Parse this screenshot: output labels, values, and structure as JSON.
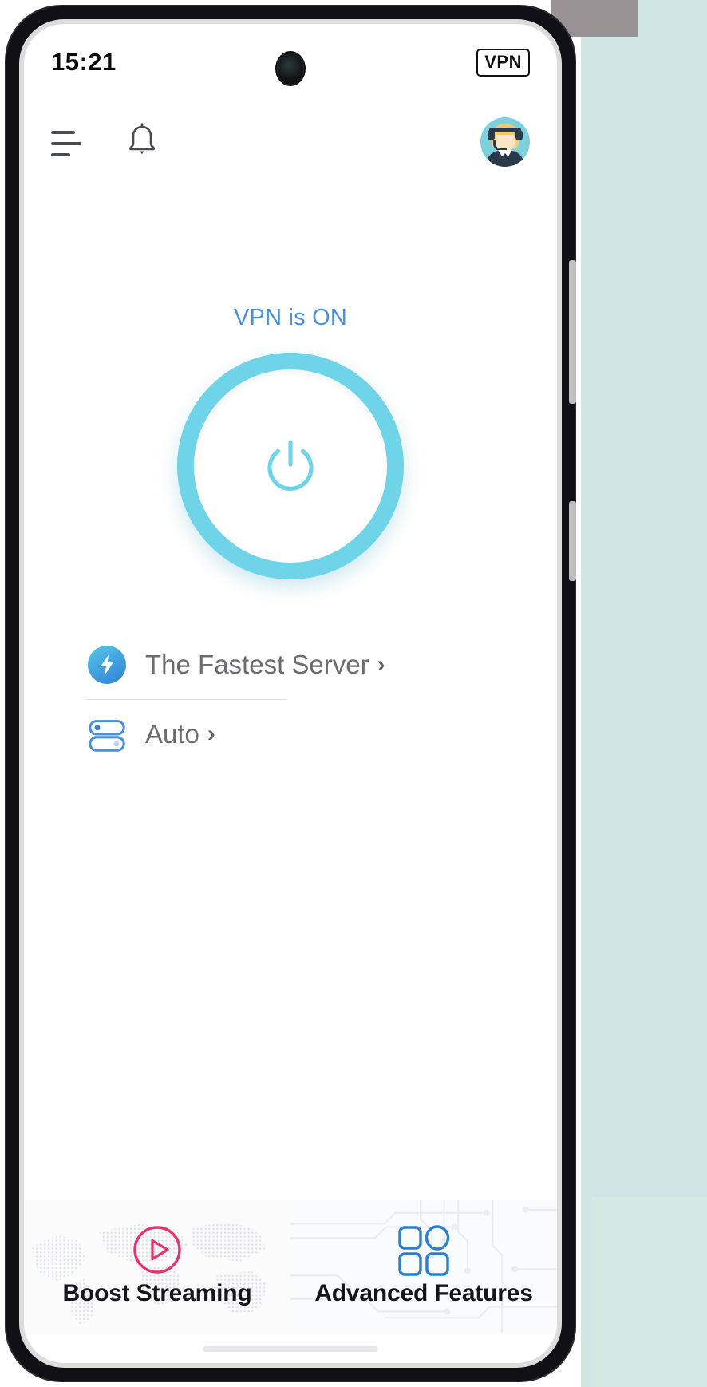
{
  "status_bar": {
    "time": "15:21",
    "vpn_badge": "VPN"
  },
  "header": {
    "menu_icon": "hamburger-menu-icon",
    "notifications_icon": "bell-icon",
    "avatar_icon": "support-agent-avatar"
  },
  "main": {
    "connection_status": "VPN is ON",
    "power_button_icon": "power-icon",
    "power_state": "on",
    "options": [
      {
        "label": "The Fastest Server",
        "icon": "lightning-bolt-icon",
        "chevron": "›"
      },
      {
        "label": "Auto",
        "icon": "protocol-toggle-icon",
        "chevron": "›"
      }
    ]
  },
  "bottom_cards": [
    {
      "label": "Boost Streaming",
      "icon": "play-circle-icon",
      "pattern": "world-map-dots"
    },
    {
      "label": "Advanced Features",
      "icon": "grid-apps-icon",
      "pattern": "circuit-board"
    }
  ],
  "colors": {
    "accent_cyan": "#6fd4e8",
    "status_blue": "#4a90d9",
    "bolt_blue": "#2f7fd6",
    "play_pink": "#e5336c",
    "grid_blue": "#2a7fd4",
    "label_grey": "#6b6b72"
  }
}
